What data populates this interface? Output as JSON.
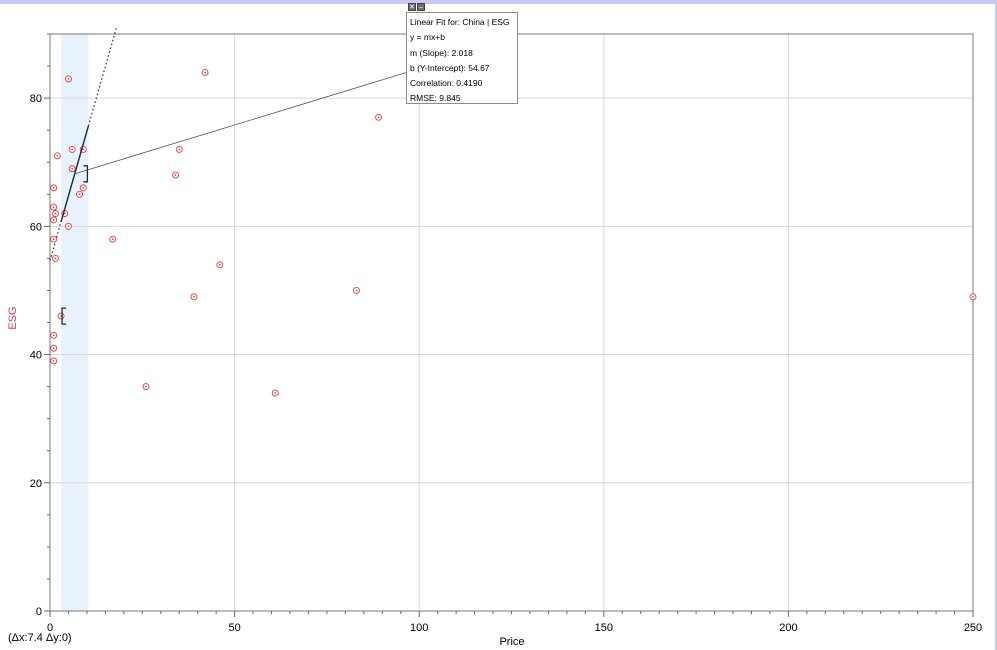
{
  "chart_data": {
    "type": "scatter",
    "xlabel": "Price",
    "ylabel": "ESG",
    "xlim": [
      0,
      250
    ],
    "ylim": [
      0,
      90
    ],
    "x_ticks": [
      0,
      50,
      100,
      150,
      200,
      250
    ],
    "y_ticks": [
      0,
      20,
      40,
      60,
      80
    ],
    "grid": true,
    "colors": {
      "points": "#e03a3a",
      "ylabel": "#e0304a",
      "fit_line": "#1a2b44",
      "highlight_band": "#e8f2fd",
      "grid": "#d9d9d9"
    },
    "highlight_band_x": [
      3,
      10.4
    ],
    "points": [
      {
        "x": 5,
        "y": 83
      },
      {
        "x": 42,
        "y": 84
      },
      {
        "x": 89,
        "y": 77
      },
      {
        "x": 2,
        "y": 71
      },
      {
        "x": 6,
        "y": 72
      },
      {
        "x": 9,
        "y": 72
      },
      {
        "x": 35,
        "y": 72
      },
      {
        "x": 6,
        "y": 69
      },
      {
        "x": 34,
        "y": 68
      },
      {
        "x": 1,
        "y": 66
      },
      {
        "x": 9,
        "y": 66
      },
      {
        "x": 8,
        "y": 65
      },
      {
        "x": 1,
        "y": 63
      },
      {
        "x": 1.5,
        "y": 62
      },
      {
        "x": 4,
        "y": 62
      },
      {
        "x": 1,
        "y": 61
      },
      {
        "x": 5,
        "y": 60
      },
      {
        "x": 1,
        "y": 58
      },
      {
        "x": 17,
        "y": 58
      },
      {
        "x": 1.5,
        "y": 55
      },
      {
        "x": 46,
        "y": 54
      },
      {
        "x": 83,
        "y": 50
      },
      {
        "x": 39,
        "y": 49
      },
      {
        "x": 250,
        "y": 49
      },
      {
        "x": 3,
        "y": 46
      },
      {
        "x": 1,
        "y": 43
      },
      {
        "x": 1,
        "y": 41
      },
      {
        "x": 1,
        "y": 39
      },
      {
        "x": 26,
        "y": 35
      },
      {
        "x": 61,
        "y": 34
      }
    ],
    "fit": {
      "title": "Linear Fit for: China | ESG",
      "equation": "y = mx+b",
      "slope": "m (Slope): 2.018",
      "intercept": "b (Y-Intercept): 54.67",
      "correlation": "Correlation: 0.4190",
      "rmse": "RMSE: 9.845",
      "m": 2.018,
      "b": 54.67,
      "solid_x": [
        3,
        10.4
      ],
      "dotted_x": [
        0,
        18
      ]
    }
  },
  "readout": "(Δx:7.4 Δy:0)",
  "popup_buttons": {
    "close": "✕",
    "minimize": "–"
  }
}
